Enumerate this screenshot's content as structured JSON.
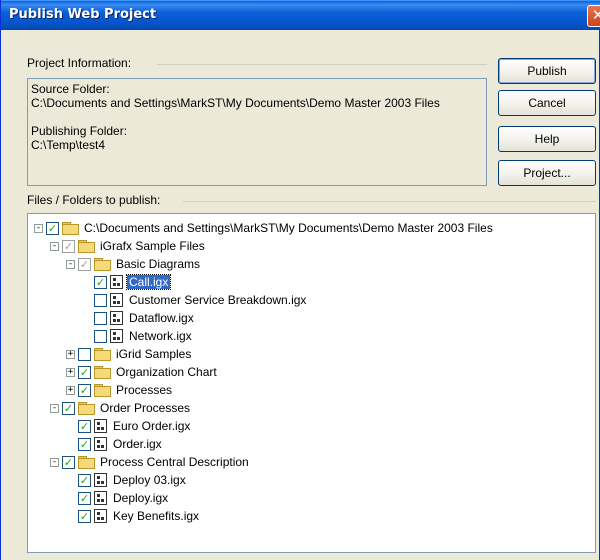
{
  "window": {
    "title": "Publish Web Project",
    "close_glyph": "✕"
  },
  "project_info": {
    "group_label": "Project Information:",
    "source_label": "Source Folder:",
    "source_value": "C:\\Documents and Settings\\MarkST\\My Documents\\Demo Master 2003 Files",
    "publishing_label": "Publishing Folder:",
    "publishing_value": "C:\\Temp\\test4"
  },
  "buttons": {
    "publish": "Publish",
    "cancel": "Cancel",
    "help": "Help",
    "project": "Project..."
  },
  "files": {
    "group_label": "Files / Folders to publish:",
    "tree": [
      {
        "label": "C:\\Documents and Settings\\MarkST\\My Documents\\Demo Master 2003 Files",
        "type": "folder",
        "checked": true,
        "expander": "-"
      },
      {
        "label": "iGrafx Sample Files",
        "type": "folder",
        "checked": "partial",
        "expander": "-"
      },
      {
        "label": "Basic Diagrams",
        "type": "folder",
        "checked": "partial",
        "expander": "-"
      },
      {
        "label": "Call.igx",
        "type": "file",
        "checked": true,
        "selected": true
      },
      {
        "label": "Customer Service Breakdown.igx",
        "type": "file",
        "checked": false
      },
      {
        "label": "Dataflow.igx",
        "type": "file",
        "checked": false
      },
      {
        "label": "Network.igx",
        "type": "file",
        "checked": false
      },
      {
        "label": "iGrid Samples",
        "type": "folder",
        "checked": false,
        "expander": "+"
      },
      {
        "label": "Organization Chart",
        "type": "folder",
        "checked": true,
        "expander": "+"
      },
      {
        "label": "Processes",
        "type": "folder",
        "checked": true,
        "expander": "+"
      },
      {
        "label": "Order Processes",
        "type": "folder",
        "checked": true,
        "expander": "-"
      },
      {
        "label": "Euro Order.igx",
        "type": "file",
        "checked": true
      },
      {
        "label": "Order.igx",
        "type": "file",
        "checked": true
      },
      {
        "label": "Process Central Description",
        "type": "folder",
        "checked": true,
        "expander": "-"
      },
      {
        "label": "Deploy 03.igx",
        "type": "file",
        "checked": true
      },
      {
        "label": "Deploy.igx",
        "type": "file",
        "checked": true
      },
      {
        "label": "Key Benefits.igx",
        "type": "file",
        "checked": true
      }
    ]
  }
}
